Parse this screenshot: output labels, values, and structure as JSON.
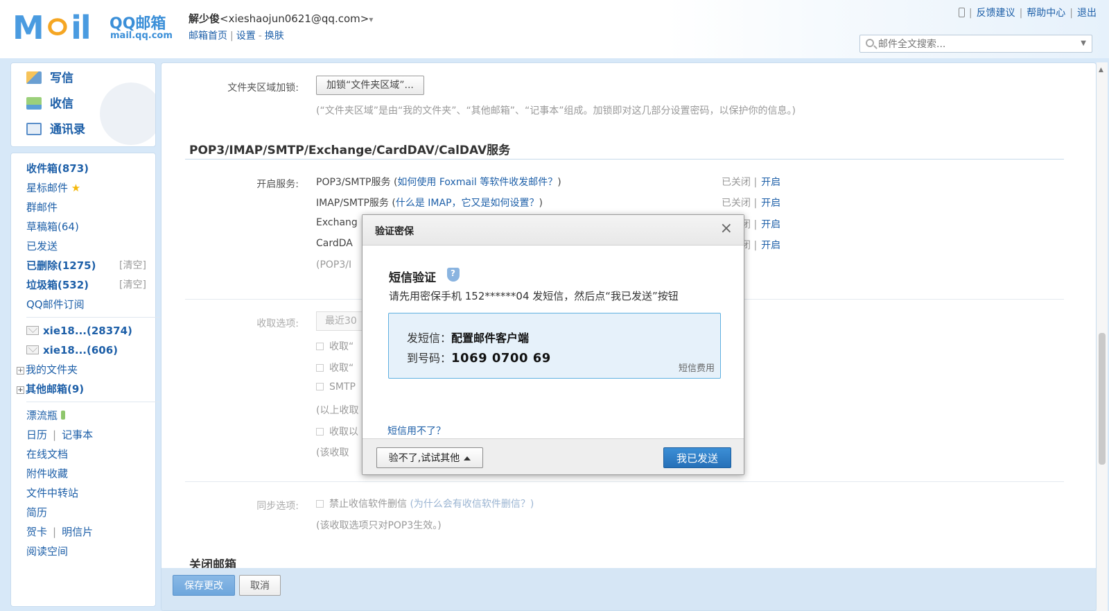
{
  "header": {
    "logo_text": "M",
    "logo_o": "ㅇ",
    "logo_tail": "il",
    "brand": "QQ邮箱",
    "domain": "mail.qq.com",
    "user_name": "解少俊",
    "user_email": "<xieshaojun0621@qq.com>",
    "user_caret": "▾",
    "nav_home": "邮箱首页",
    "nav_sep1": "|",
    "nav_settings": "设置",
    "nav_sep2": "-",
    "nav_skin": "换肤",
    "link_feedback": "反馈建议",
    "link_help": "帮助中心",
    "link_logout": "退出",
    "link_sep": "|",
    "search_placeholder": "邮件全文搜索..."
  },
  "sidebar": {
    "actions": {
      "write": "写信",
      "receive": "收信",
      "contacts": "通讯录"
    },
    "folders": {
      "inbox": "收件箱(873)",
      "starred": "星标邮件",
      "group": "群邮件",
      "drafts": "草稿箱(64)",
      "sent": "已发送",
      "deleted": "已删除(1275)",
      "deleted_clear": "[清空]",
      "spam": "垃圾箱(532)",
      "spam_clear": "[清空]",
      "subscription": "QQ邮件订阅",
      "account1": "xie18...(28374)",
      "account2": "xie18...(606)",
      "my_folders": "我的文件夹",
      "other_mailboxes": "其他邮箱(9)",
      "drift_bottle": "漂流瓶",
      "calendar": "日历",
      "notebook": "记事本",
      "online_docs": "在线文档",
      "attachments": "附件收藏",
      "file_transfer": "文件中转站",
      "resume": "简历",
      "greeting_cards": "贺卡",
      "postcards": "明信片",
      "reading_space": "阅读空间",
      "pipe": "|"
    }
  },
  "main": {
    "folder_lock_label": "文件夹区域加锁:",
    "folder_lock_button": "加锁“文件夹区域”...",
    "folder_lock_note": "(“文件夹区域”是由“我的文件夹”、“其他邮箱”、“记事本”组成。加锁即对这几部分设置密码，以保护你的信息。)",
    "services_title": "POP3/IMAP/SMTP/Exchange/CardDAV/CalDAV服务",
    "enable_label": "开启服务:",
    "services": [
      {
        "name": "POP3/SMTP服务 (",
        "link": "如何使用 Foxmail 等软件收发邮件？",
        "close": ")",
        "status": "已关闭",
        "sep": "|",
        "action": "开启"
      },
      {
        "name": "IMAP/SMTP服务 (",
        "link": "什么是 IMAP，它又是如何设置？",
        "close": ")",
        "status": "已关闭",
        "sep": "|",
        "action": "开启"
      },
      {
        "name": "Exchang",
        "link": "",
        "close": "",
        "status": "已关闭",
        "sep": "|",
        "action": "开启"
      },
      {
        "name": "CardDA",
        "link": "",
        "close": "",
        "status": "已关闭",
        "sep": "|",
        "action": "开启"
      }
    ],
    "pop3_note": "(POP3/I",
    "receive_label": "收取选项:",
    "receive_select": "最近30",
    "receive_opt1": "收取“",
    "receive_opt2": "收取“",
    "receive_opt3": "SMTP",
    "receive_note1": "(以上收取",
    "receive_opt4": "收取以",
    "receive_note2": "(该收取",
    "sync_label": "同步选项:",
    "sync_opt": "禁止收信软件删信",
    "sync_link": "(为什么会有收信软件删信？)",
    "sync_note": "(该收取选项只对POP3生效。)",
    "close_mailbox_title": "关闭邮箱",
    "save_button": "保存更改",
    "cancel_button": "取消"
  },
  "dialog": {
    "title": "验证密保",
    "close": "×",
    "sms_title": "短信验证",
    "sms_desc": "请先用密保手机 152******04 发短信，然后点“我已发送”按钮",
    "send_label": "发短信：",
    "send_value": "配置邮件客户端",
    "to_label": "到号码：",
    "to_value": "1069 0700 69",
    "fee": "短信费用",
    "help_link": "短信用不了？",
    "other_button": "验不了,试试其他",
    "sent_button": "我已发送"
  }
}
